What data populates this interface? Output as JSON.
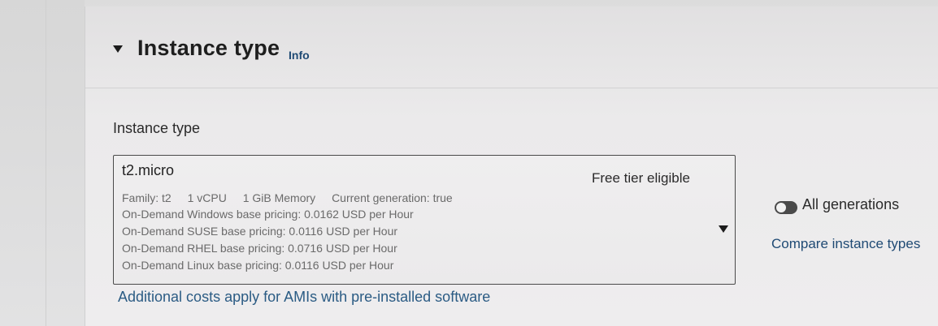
{
  "section": {
    "title": "Instance type",
    "info_label": "Info"
  },
  "field": {
    "label": "Instance type"
  },
  "selected_instance": {
    "name": "t2.micro",
    "badge": "Free tier eligible",
    "family": "Family: t2",
    "vcpu": "1 vCPU",
    "memory": "1 GiB Memory",
    "generation": "Current generation: true",
    "pricing": [
      "On-Demand Windows base pricing: 0.0162 USD per Hour",
      "On-Demand SUSE base pricing: 0.0116 USD per Hour",
      "On-Demand RHEL base pricing: 0.0716 USD per Hour",
      "On-Demand Linux base pricing: 0.0116 USD per Hour"
    ]
  },
  "options": {
    "all_generations_label": "All generations",
    "all_generations_on": false,
    "compare_label": "Compare instance types"
  },
  "footer": {
    "additional_costs": "Additional costs apply for AMIs with pre-installed software"
  },
  "colors": {
    "link": "#1f4a74",
    "text": "#2a2a2a",
    "muted": "#6a6a6a"
  },
  "icons": [
    "caret-down-icon",
    "dropdown-caret-icon",
    "toggle-switch"
  ]
}
